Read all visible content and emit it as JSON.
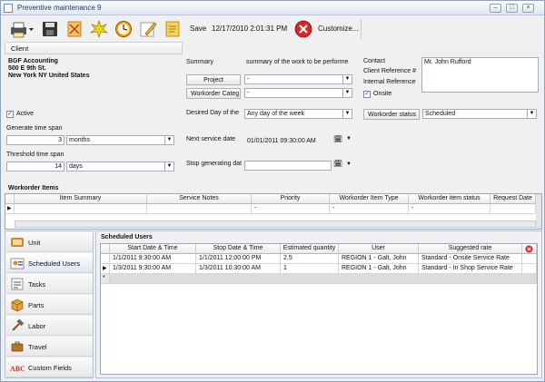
{
  "window": {
    "title": "Preventive maintenance 9"
  },
  "toolbar": {
    "save_label": "Save",
    "datetime": "12/17/2010 2:01:31 PM",
    "customize_label": "Customize..."
  },
  "client": {
    "button_label": "Client",
    "name": "BGF Accounting",
    "address1": "500 E 9th St.",
    "address2": "New York NY United States"
  },
  "summary": {
    "label": "Summary",
    "value": "summary of the work to be performe"
  },
  "project": {
    "label": "Project",
    "value": "-"
  },
  "workorder_category": {
    "label": "Workorder Categ",
    "value": "-"
  },
  "contact": {
    "label": "Contact",
    "value": "Mr. John Rufford"
  },
  "client_reference": {
    "label": "Client Reference #"
  },
  "internal_reference": {
    "label": "Internal Reference"
  },
  "onsite": {
    "label": "Onsite",
    "checked": true
  },
  "active": {
    "label": "Active",
    "checked": true
  },
  "generate_span": {
    "label": "Generate time span",
    "value": "3",
    "unit": "months"
  },
  "threshold_span": {
    "label": "Threshold time span",
    "value": "14",
    "unit": "days"
  },
  "desired_day": {
    "label": "Desired Day of the",
    "value": "Any day of the week"
  },
  "workorder_status": {
    "label": "Workorder status",
    "value": "Scheduled"
  },
  "next_service": {
    "label": "Next service date",
    "value": "01/01/2011 09:30:00 AM"
  },
  "stop_generating": {
    "label": "Stop generating dat",
    "value": ""
  },
  "workorder_items": {
    "title": "Workorder Items",
    "columns": [
      "Item Summary",
      "Service Notes",
      "Priority",
      "Workorder Item Type",
      "Workorder item status",
      "Request Date"
    ],
    "rows": [
      [
        "",
        "",
        "-",
        "-",
        "-",
        ""
      ]
    ]
  },
  "sidebar": {
    "items": [
      {
        "label": "Unit",
        "icon": "unit-icon"
      },
      {
        "label": "Scheduled Users",
        "icon": "users-icon"
      },
      {
        "label": "Tasks",
        "icon": "tasks-icon"
      },
      {
        "label": "Parts",
        "icon": "parts-icon"
      },
      {
        "label": "Labor",
        "icon": "labor-icon"
      },
      {
        "label": "Travel",
        "icon": "travel-icon"
      },
      {
        "label": "Custom Fields",
        "icon": "abc-icon"
      }
    ]
  },
  "scheduled_users": {
    "title": "Scheduled Users",
    "columns": [
      "Start Date & Time",
      "Stop Date & Time",
      "Estimated quantity",
      "User",
      "Suggested rate"
    ],
    "rows": [
      [
        "1/1/2011 9:30:00 AM",
        "1/1/2011 12:00:00 PM",
        "2.5",
        "REGION 1 - Galt, John",
        "Standard - Onsite Service Rate"
      ],
      [
        "1/3/2011 9:30:00 AM",
        "1/3/2011 10:30:00 AM",
        "1",
        "REGION 1 - Galt, John",
        "Standard - In Shop Service Rate"
      ]
    ]
  },
  "colors": {
    "accent": "#2b5797",
    "delete": "#d9262b"
  }
}
